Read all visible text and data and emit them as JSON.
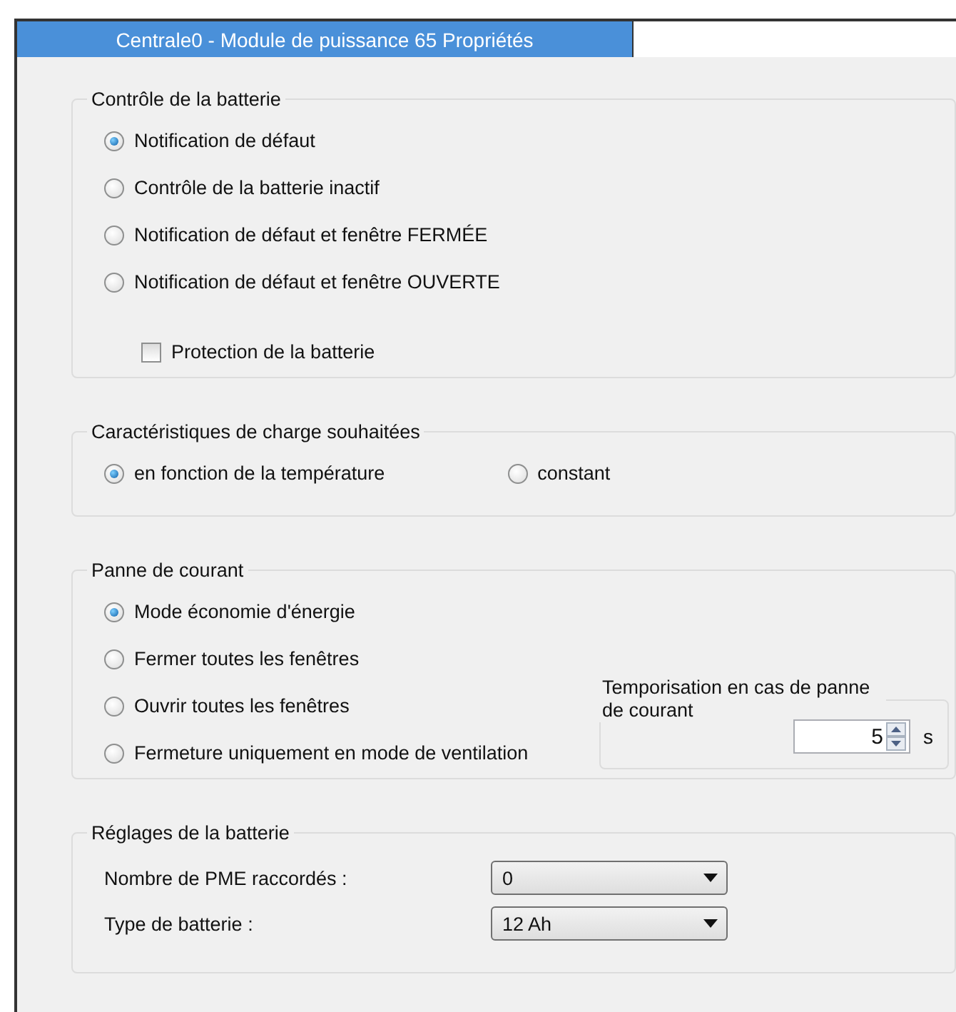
{
  "window": {
    "title": "Centrale0 - Module de puissance 65 Propriétés"
  },
  "groups": [
    {
      "kind": "radios",
      "title": "Contrôle de la batterie",
      "options": [
        {
          "label": "Notification de défaut",
          "selected": true
        },
        {
          "label": "Contrôle de la batterie inactif",
          "selected": false
        },
        {
          "label": "Notification de défaut et fenêtre FERMÉE",
          "selected": false
        },
        {
          "label": "Notification de défaut et fenêtre OUVERTE",
          "selected": false
        }
      ],
      "checkbox": {
        "label": "Protection de la batterie",
        "checked": false
      }
    },
    {
      "kind": "radio_row",
      "title": "Caractéristiques de charge souhaitées",
      "options": [
        {
          "label": "en fonction de la température",
          "selected": true
        },
        {
          "label": "constant",
          "selected": false
        }
      ]
    },
    {
      "kind": "radios",
      "title": "Panne de courant",
      "options": [
        {
          "label": "Mode économie d'énergie",
          "selected": true
        },
        {
          "label": "Fermer toutes les fenêtres",
          "selected": false
        },
        {
          "label": "Ouvrir toutes les fenêtres",
          "selected": false
        },
        {
          "label": "Fermeture uniquement en mode de ventilation",
          "selected": false
        }
      ],
      "delay": {
        "title": "Temporisation en cas de panne de courant",
        "value": "5",
        "unit": "s"
      }
    },
    {
      "kind": "settings",
      "title": "Réglages de la batterie",
      "rows": [
        {
          "label": "Nombre de PME raccordés :",
          "value": "0"
        },
        {
          "label": "Type de batterie :",
          "value": "12 Ah"
        }
      ]
    }
  ]
}
